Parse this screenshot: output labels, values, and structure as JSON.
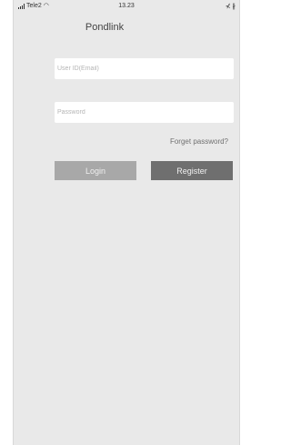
{
  "status_bar": {
    "carrier": "Tele2",
    "time": "13.23",
    "right": "⊀ ∦"
  },
  "header": {
    "title": "Pondlink"
  },
  "login_form": {
    "email_placeholder": "User ID(Email)",
    "email_value": "",
    "password_placeholder": "Password",
    "password_value": "",
    "forgot_label": "Forget password?",
    "login_label": "Login",
    "register_label": "Register"
  },
  "icons": {
    "signal": "signal-icon",
    "wifi": "wifi-icon"
  },
  "colors": {
    "background": "#e9e9e9",
    "field": "#ffffff",
    "login_button": "#a8a8a8",
    "register_button": "#6f6f6f",
    "button_text": "#f0f0f0"
  }
}
